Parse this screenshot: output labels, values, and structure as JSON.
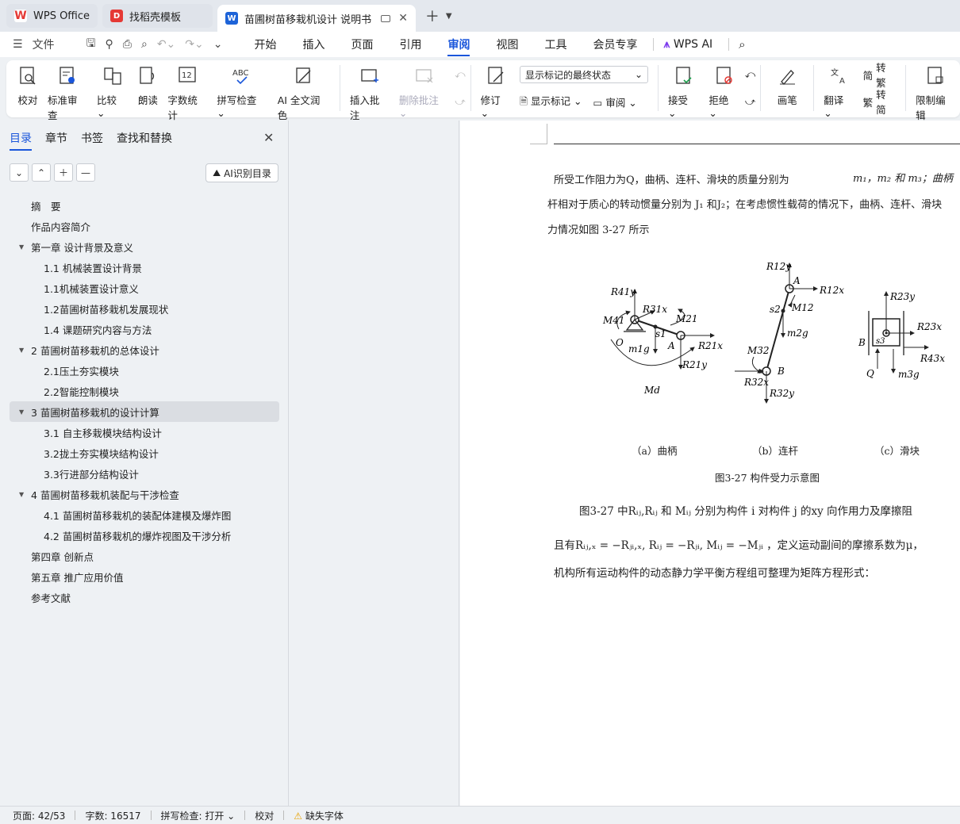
{
  "tabs": [
    {
      "label": "WPS Office",
      "icon": "wps-logo-icon"
    },
    {
      "label": "找稻壳模板",
      "icon": "docer-icon"
    },
    {
      "label": "苗圃树苗移栽机设计 说明书",
      "icon": "word-doc-icon"
    }
  ],
  "menu": {
    "file": "文件",
    "items": [
      "开始",
      "插入",
      "页面",
      "引用",
      "审阅",
      "视图",
      "工具",
      "会员专享"
    ],
    "active": "审阅",
    "wps_ai": "WPS AI"
  },
  "ribbon": {
    "proofread": "校对",
    "std_review": "标准审查",
    "compare": "比较",
    "read_aloud": "朗读",
    "word_count": "字数统计",
    "spell_check": "拼写检查",
    "ai_polish": "AI 全文润色",
    "insert_comment": "插入批注",
    "delete_comment": "删除批注",
    "track_changes": "修订",
    "markup_state": "显示标记的最终状态",
    "show_markup": "显示标记",
    "review": "审阅",
    "accept": "接受",
    "reject": "拒绝",
    "pen": "画笔",
    "translate": "翻译",
    "to_traditional": "转繁",
    "to_simplified": "转简",
    "restrict_edit": "限制编辑"
  },
  "sidebar": {
    "tabs": [
      "目录",
      "章节",
      "书签",
      "查找和替换"
    ],
    "ai_button": "AI识别目录",
    "toc": [
      {
        "label": "摘　要",
        "level": 0,
        "arrow": false
      },
      {
        "label": "作品内容简介",
        "level": 0,
        "arrow": false
      },
      {
        "label": "第一章 设计背景及意义",
        "level": 0,
        "arrow": true
      },
      {
        "label": "1.1 机械装置设计背景",
        "level": 1,
        "arrow": false
      },
      {
        "label": "1.1机械装置设计意义",
        "level": 1,
        "arrow": false
      },
      {
        "label": "1.2苗圃树苗移栽机发展现状",
        "level": 1,
        "arrow": false
      },
      {
        "label": "1.4 课题研究内容与方法",
        "level": 1,
        "arrow": false
      },
      {
        "label": "2 苗圃树苗移栽机的总体设计",
        "level": 0,
        "arrow": true
      },
      {
        "label": "2.1压土夯实模块",
        "level": 1,
        "arrow": false
      },
      {
        "label": "2.2智能控制模块",
        "level": 1,
        "arrow": false
      },
      {
        "label": "3 苗圃树苗移栽机的设计计算",
        "level": 0,
        "arrow": true,
        "selected": true
      },
      {
        "label": "3.1 自主移栽模块结构设计",
        "level": 1,
        "arrow": false
      },
      {
        "label": "3.2拢土夯实模块结构设计",
        "level": 1,
        "arrow": false
      },
      {
        "label": "3.3行进部分结构设计",
        "level": 1,
        "arrow": false
      },
      {
        "label": "4 苗圃树苗移栽机装配与干涉检查",
        "level": 0,
        "arrow": true
      },
      {
        "label": "4.1  苗圃树苗移栽机的装配体建模及爆炸图",
        "level": 1,
        "arrow": false
      },
      {
        "label": "4.2 苗圃树苗移栽机的爆炸视图及干涉分析",
        "level": 1,
        "arrow": false
      },
      {
        "label": "第四章 创新点",
        "level": 0,
        "arrow": false
      },
      {
        "label": "第五章 推广应用价值",
        "level": 0,
        "arrow": false
      },
      {
        "label": "参考文献",
        "level": 0,
        "arrow": false
      }
    ]
  },
  "doc": {
    "p1_line1": "所受工作阻力为Q，曲柄、连杆、滑块的质量分别为",
    "p1_masses": "m₁，m₂ 和 m₃；曲柄",
    "p1_line2": "杆相对于质心的转动惯量分别为 J₁ 和J₂；在考虑惯性载荷的情况下，曲柄、连杆、滑块",
    "p1_line3": "力情况如图 3-27  所示",
    "sub_a": "（a）曲柄",
    "sub_b": "（b）连杆",
    "sub_c": "（c）滑块",
    "figure_caption": "图3-27  构件受力示意图",
    "p2_line1": "图3-27  中Rᵢⱼ,Rᵢⱼ 和 Mᵢⱼ 分别为构件 i  对构件 j  的xy  向作用力及摩擦阻",
    "p2_line2": "且有Rᵢⱼ,ₓ  = −Rⱼᵢ,ₓ, Rᵢⱼ  = −Rⱼᵢ, Mᵢⱼ  = −Mⱼᵢ ，定义运动副间的摩擦系数为μ，",
    "p2_line3": "机构所有运动构件的动态静力学平衡方程组可整理为矩阵方程形式：",
    "fig_labels": {
      "R41y": "R41y",
      "R31x": "R31x",
      "M41": "M41",
      "M21": "M21",
      "s1": "s1",
      "O": "O",
      "m1g": "m1g",
      "A1": "A",
      "R21x": "R21x",
      "R21y": "R21y",
      "Md": "Md",
      "R12y": "R12y",
      "A2": "A",
      "R12x": "R12x",
      "s2": "s2",
      "M12": "M12",
      "m2g": "m2g",
      "M32": "M32",
      "B2": "B",
      "R32x": "R32x",
      "R32y": "R32y",
      "R23y": "R23y",
      "R23x": "R23x",
      "B3": "B",
      "s3": "s3",
      "R43x": "R43x",
      "Q": "Q",
      "m3g": "m3g"
    }
  },
  "status": {
    "page": "页面: 42/53",
    "words": "字数: 16517",
    "spell": "拼写检查: 打开",
    "proof": "校对",
    "missing_font": "缺失字体"
  },
  "colors": {
    "accent": "#1a56db",
    "wps_red": "#e53935",
    "word_blue": "#1d63d8"
  }
}
